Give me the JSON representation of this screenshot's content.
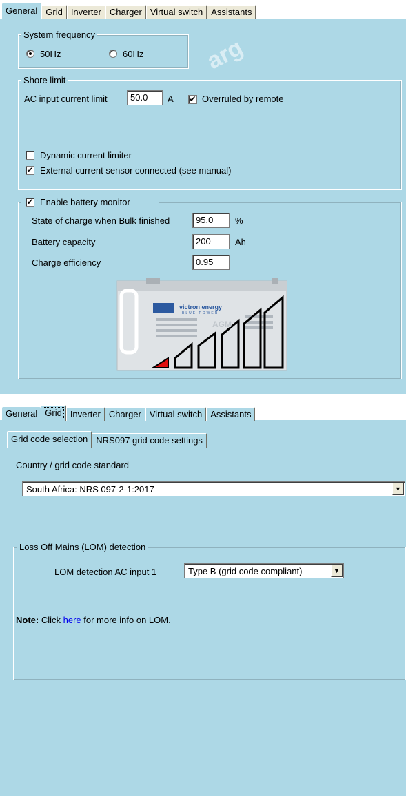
{
  "panel1": {
    "tabs": [
      "General",
      "Grid",
      "Inverter",
      "Charger",
      "Virtual switch",
      "Assistants"
    ],
    "system_frequency": {
      "legend": "System frequency",
      "options": [
        {
          "label": "50Hz",
          "selected": true
        },
        {
          "label": "60Hz",
          "selected": false
        }
      ]
    },
    "shore_limit": {
      "legend": "Shore limit",
      "ac_input_label": "AC input current limit",
      "ac_input_value": "50.0",
      "ac_input_unit": "A",
      "overruled_label": "Overruled by remote",
      "overruled_checked": true,
      "dynamic_label": "Dynamic current limiter",
      "dynamic_checked": false,
      "external_label": "External current sensor connected (see manual)",
      "external_checked": true
    },
    "battery_monitor": {
      "legend": "Enable battery monitor",
      "enabled": true,
      "soc_label": "State of charge when Bulk finished",
      "soc_value": "95.0",
      "soc_unit": "%",
      "capacity_label": "Battery capacity",
      "capacity_value": "200",
      "capacity_unit": "Ah",
      "efficiency_label": "Charge efficiency",
      "efficiency_value": "0.95",
      "battery_brand": "victron energy",
      "battery_tagline": "BLUE POWER",
      "battery_model": "AGM"
    }
  },
  "panel2": {
    "tabs": [
      "General",
      "Grid",
      "Inverter",
      "Charger",
      "Virtual switch",
      "Assistants"
    ],
    "subtabs": [
      "Grid code selection",
      "NRS097 grid code settings"
    ],
    "country_label": "Country / grid code standard",
    "country_value": "South Africa:   NRS 097-2-1:2017",
    "lom": {
      "legend": "Loss Off Mains (LOM) detection",
      "ac_input_label": "LOM detection AC input 1",
      "ac_input_value": "Type B (grid code compliant)",
      "note_bold": "Note:",
      "note_pre": " Click ",
      "note_link": "here",
      "note_post": " for more info on LOM."
    }
  },
  "colors": {
    "panel": "#add8e6",
    "link": "#0000ee",
    "battery_red": "#e01010"
  }
}
